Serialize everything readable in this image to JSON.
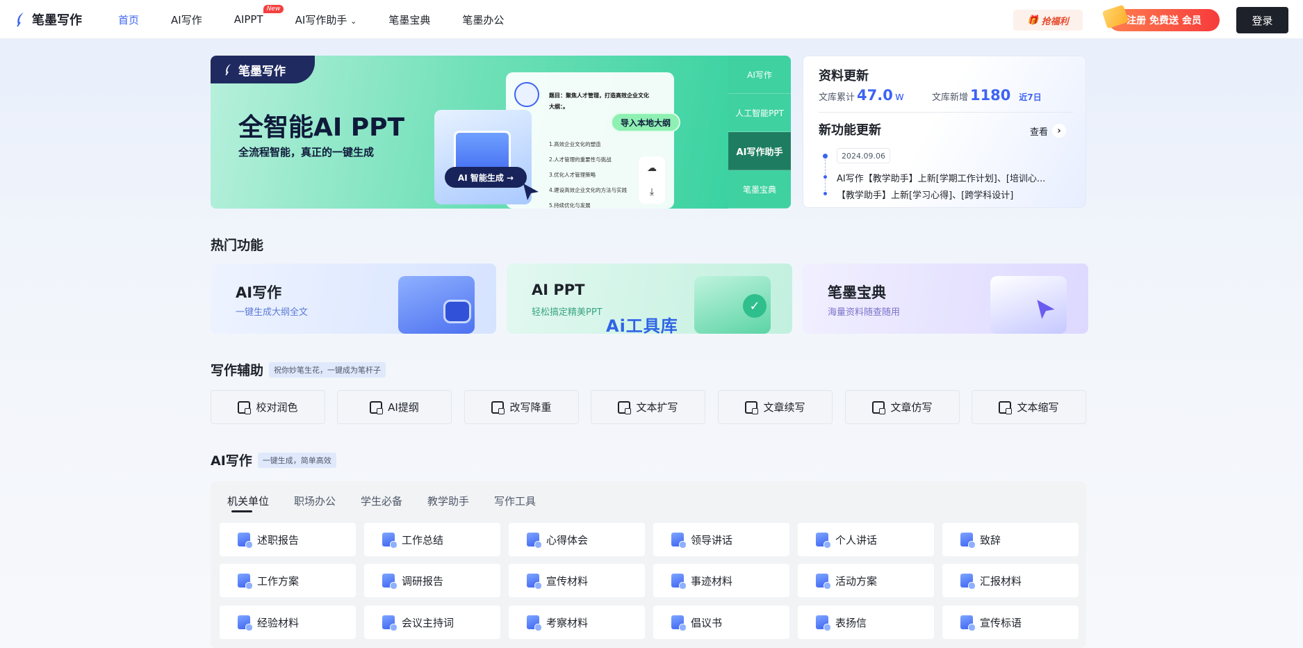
{
  "header": {
    "logo_text": "笔墨写作",
    "nav": [
      {
        "label": "首页",
        "active": true
      },
      {
        "label": "AI写作"
      },
      {
        "label": "AIPPT",
        "badge": "New"
      },
      {
        "label": "AI写作助手",
        "dropdown": true
      },
      {
        "label": "笔墨宝典"
      },
      {
        "label": "笔墨办公"
      }
    ],
    "welfare_label": "抢福利",
    "vip_label": "注册 免费送 会员",
    "login_label": "登录"
  },
  "banner": {
    "tag": "笔墨写作",
    "title": "全智能AI PPT",
    "subtitle": "全流程智能，真正的一键生成",
    "doc_head": "题目：聚焦人才管理，打造高效企业文化大纲：。",
    "doc_lines": [
      "1.高效企业文化的塑造",
      "2.人才管理的重要性与挑战",
      "3.优化人才管理策略",
      "4.建设高效企业文化的方法与实践",
      "5.持续优化与发展"
    ],
    "ai_button": "AI 智能生成 →",
    "import_tag": "导入本地大纲",
    "side_tabs": [
      {
        "label": "AI写作"
      },
      {
        "label": "人工智能PPT"
      },
      {
        "label": "AI写作助手",
        "selected": true
      },
      {
        "label": "笔墨宝典"
      }
    ]
  },
  "updates": {
    "title": "资料更新",
    "total_label": "文库累计",
    "total_value": "47.0",
    "total_unit": "w",
    "new_label": "文库新增",
    "new_value": "1180",
    "period": "近7日",
    "feature_title": "新功能更新",
    "see_label": "查看",
    "date": "2024.09.06",
    "items": [
      "AI写作【教学助手】上新[学期工作计划]、[培训心...",
      "【教学助手】上新[学习心得]、[跨学科设计]"
    ]
  },
  "hot": {
    "title": "热门功能",
    "cards": [
      {
        "title": "AI写作",
        "sub": "一键生成大纲全文"
      },
      {
        "title": "AI PPT",
        "sub": "轻松搞定精美PPT"
      },
      {
        "title": "笔墨宝典",
        "sub": "海量资料随查随用"
      }
    ],
    "watermark": "Ai工具库"
  },
  "assist": {
    "title": "写作辅助",
    "tag": "祝你妙笔生花，一键成为笔杆子",
    "buttons": [
      "校对润色",
      "AI提纲",
      "改写降重",
      "文本扩写",
      "文章续写",
      "文章仿写",
      "文本缩写"
    ]
  },
  "writing": {
    "title": "AI写作",
    "tag": "一键生成，简单高效",
    "tabs": [
      "机关单位",
      "职场办公",
      "学生必备",
      "教学助手",
      "写作工具"
    ],
    "items": [
      "述职报告",
      "工作总结",
      "心得体会",
      "领导讲话",
      "个人讲话",
      "致辞",
      "工作方案",
      "调研报告",
      "宣传材料",
      "事迹材料",
      "活动方案",
      "汇报材料",
      "经验材料",
      "会议主持词",
      "考察材料",
      "倡议书",
      "表扬信",
      "宣传标语"
    ]
  }
}
